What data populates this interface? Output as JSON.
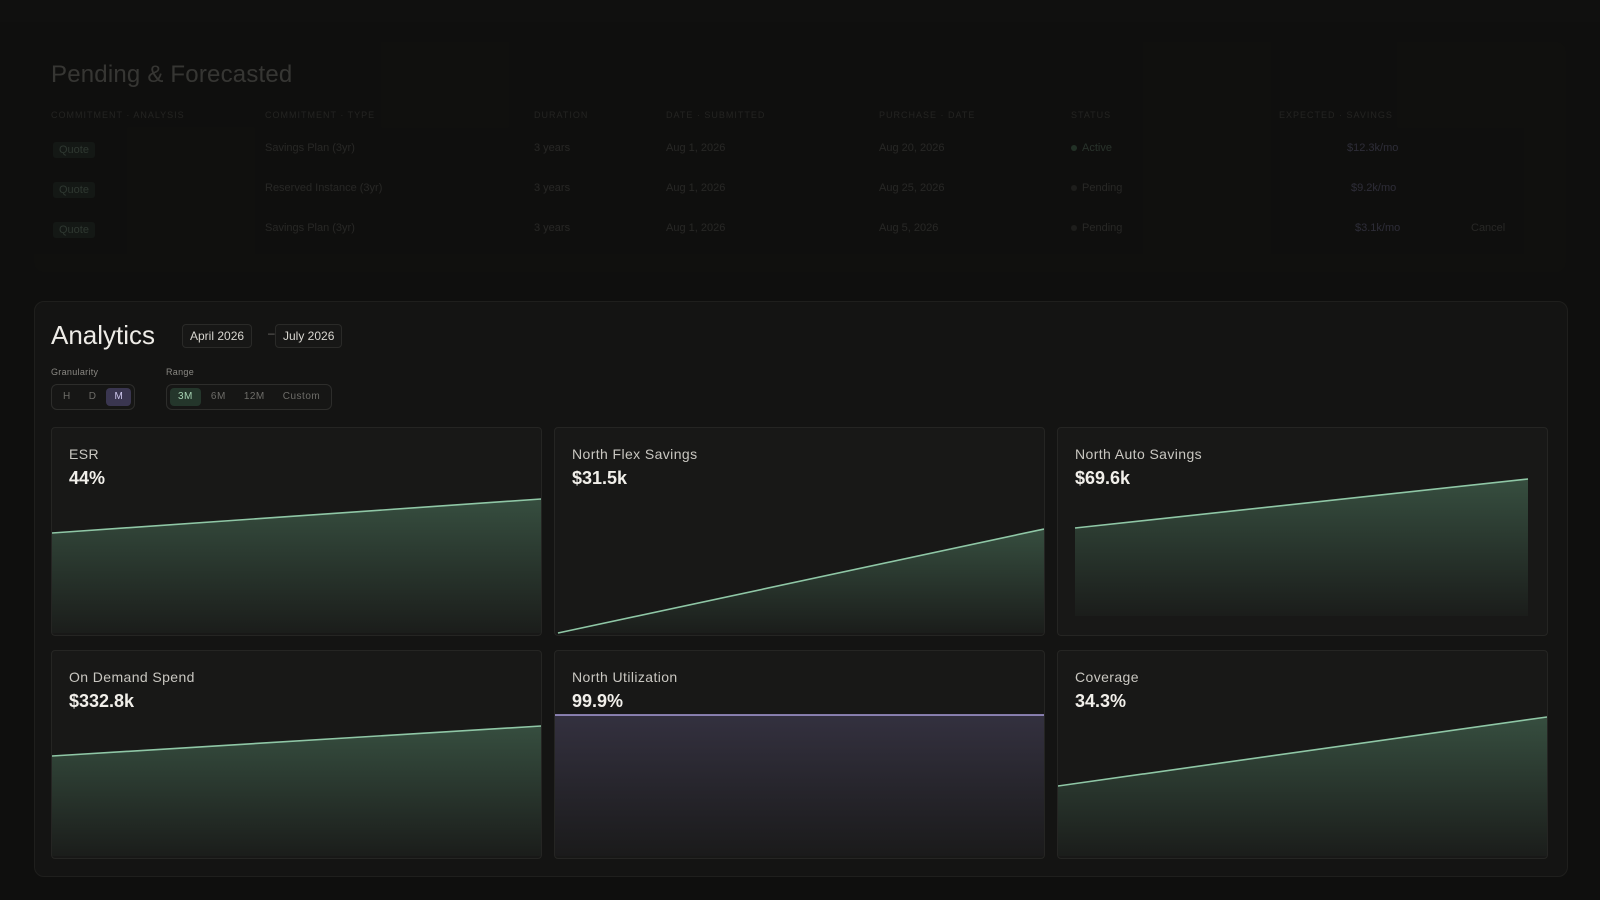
{
  "top_strip": {
    "left_text": "",
    "right_text": ""
  },
  "pending": {
    "title": "Pending & Forecasted",
    "columns": [
      "Commitment · Analysis",
      "Commitment · Type",
      "Duration",
      "Date · Submitted",
      "Purchase · Date",
      "Status",
      "Expected · Savings",
      ""
    ],
    "rows": [
      {
        "id": "Quote",
        "type": "Savings Plan (3yr)",
        "duration": "3 years",
        "submitted": "Aug 1, 2026",
        "purchase": "Aug 20, 2026",
        "status": "Active",
        "savings": "$12.3k/mo",
        "extra": ""
      },
      {
        "id": "Quote",
        "type": "Reserved Instance (3yr)",
        "duration": "3 years",
        "submitted": "Aug 1, 2026",
        "purchase": "Aug 25, 2026",
        "status": "Pending",
        "savings": "$9.2k/mo",
        "extra": ""
      },
      {
        "id": "Quote",
        "type": "Savings Plan (3yr)",
        "duration": "3 years",
        "submitted": "Aug 1, 2026",
        "purchase": "Aug 5, 2026",
        "status": "Pending",
        "savings": "$3.1k/mo",
        "extra": "Cancel"
      }
    ]
  },
  "analytics": {
    "title": "Analytics",
    "date_from": "April 2026",
    "date_sep": "–",
    "date_to": "July 2026",
    "granularity_label": "Granularity",
    "granularity_options": [
      "H",
      "D",
      "M"
    ],
    "granularity_selected": "M",
    "range_label": "Range",
    "range_options": [
      "3M",
      "6M",
      "12M",
      "Custom"
    ],
    "range_selected": "3M",
    "colors": {
      "line_green": "#8fc7a6",
      "fill_green": "#4f7a60",
      "line_purple": "#a79cd8",
      "fill_purple": "#4a4560"
    },
    "cards": [
      {
        "label": "ESR",
        "value": "44%",
        "trend": [
          0.46,
          0.64
        ],
        "color": "green"
      },
      {
        "label": "North Flex Savings",
        "value": "$31.5k",
        "trend": [
          0.0,
          0.5
        ],
        "color": "green"
      },
      {
        "label": "North Auto Savings",
        "value": "$69.6k",
        "trend": [
          0.55,
          0.81
        ],
        "color": "green"
      },
      {
        "label": "On Demand Spend",
        "value": "$332.8k",
        "trend": [
          0.48,
          0.62
        ],
        "color": "green"
      },
      {
        "label": "North Utilization",
        "value": "99.9%",
        "trend": [
          0.999,
          0.999
        ],
        "color": "purple"
      },
      {
        "label": "Coverage",
        "value": "34.3%",
        "trend": [
          0.34,
          0.68
        ],
        "color": "green"
      }
    ]
  }
}
